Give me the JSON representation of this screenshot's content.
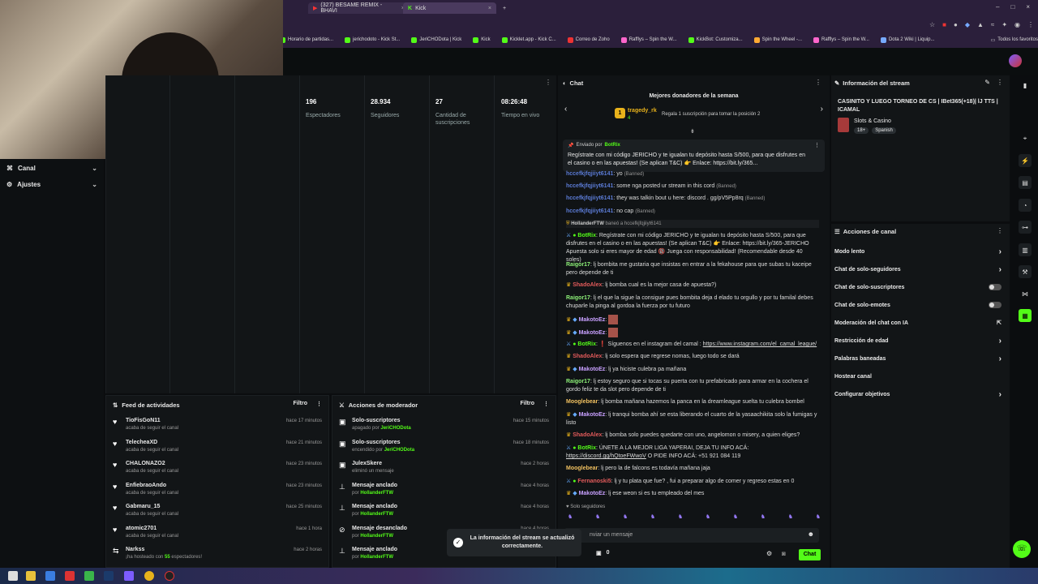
{
  "browser": {
    "tabs": [
      {
        "label": "(327) BESAME REMIX - BHAVI"
      },
      {
        "label": "Kick"
      }
    ],
    "new_tab": "+",
    "bookmarks": [
      "Horario de partidas...",
      "jerichodoto - Kick St...",
      "JeriCHODota | Kick",
      "Kick",
      "Kicklet.app - Kick C...",
      "Correo de Zoho",
      "Rafflys – Spin the W...",
      "KickBot: Customiza...",
      "Spin the Wheel -...",
      "Rafflys – Spin the W...",
      "Dota 2 Wiki | Liquip..."
    ],
    "all_bookmarks": "Todos los favoritos"
  },
  "sidebar": {
    "items": [
      {
        "label": "Canal"
      },
      {
        "label": "Ajustes"
      }
    ]
  },
  "stats": [
    {
      "value": "196",
      "label": "Espectadores"
    },
    {
      "value": "28.934",
      "label": "Seguidores"
    },
    {
      "value": "27",
      "label": "Cantidad de suscripciones"
    },
    {
      "value": "08:26:48",
      "label": "Tiempo en vivo"
    }
  ],
  "activity": {
    "title": "Feed de actividades",
    "filter": "Filtro",
    "rows": [
      {
        "name": "TioFisGoN11",
        "sub": "acaba de seguir el canal",
        "time": "hace 17 minutos",
        "icon": "heart-icon"
      },
      {
        "name": "TelecheaXD",
        "sub": "acaba de seguir el canal",
        "time": "hace 21 minutos",
        "icon": "heart-icon"
      },
      {
        "name": "CHALONAZO2",
        "sub": "acaba de seguir el canal",
        "time": "hace 23 minutos",
        "icon": "heart-icon"
      },
      {
        "name": "EnfiebraoAndo",
        "sub": "acaba de seguir el canal",
        "time": "hace 23 minutos",
        "icon": "heart-icon"
      },
      {
        "name": "Gabmaru_15",
        "sub": "acaba de seguir el canal",
        "time": "hace 25 minutos",
        "icon": "heart-icon"
      },
      {
        "name": "atomic2701",
        "sub": "acaba de seguir el canal",
        "time": "hace 1 hora",
        "icon": "heart-icon"
      },
      {
        "name": "Narkss",
        "sub_prefix": "¡ha hosteado con",
        "sub_count": "55",
        "sub_suffix": "espectadores!",
        "time": "hace 2 horas",
        "icon": "host-icon"
      }
    ]
  },
  "modactions": {
    "title": "Acciones de moderador",
    "filter": "Filtro",
    "rows": [
      {
        "name": "Solo-suscriptores",
        "pre": "apagado por",
        "by": "JeriCHODota",
        "time": "hace 15 minutos"
      },
      {
        "name": "Solo-suscriptores",
        "pre": "encendido por",
        "by": "JeriCHODota",
        "time": "hace 18 minutos"
      },
      {
        "name": "JulexSkere",
        "pre": "eliminó un mensaje",
        "by": "",
        "time": "hace 2 horas"
      },
      {
        "name": "Mensaje anclado",
        "pre": "por",
        "by": "HollanderFTW",
        "time": "hace 4 horas"
      },
      {
        "name": "Mensaje anclado",
        "pre": "por",
        "by": "HollanderFTW",
        "time": "hace 4 horas"
      },
      {
        "name": "Mensaje desanclado",
        "pre": "por",
        "by": "HollanderFTW",
        "time": "hace 4 horas"
      },
      {
        "name": "Mensaje anclado",
        "pre": "por",
        "by": "HollanderFTW",
        "time": ""
      }
    ]
  },
  "chat": {
    "title": "Chat",
    "top_donors_title": "Mejores donadores de la semana",
    "donor_rank": "1",
    "donor_name": "tragedy_rk",
    "donor_count": "4",
    "donor_cta": "Regala 1 suscripción para tomar la posición 2",
    "pinned_by_label": "Enviado por",
    "pinned_by": "BotRix",
    "pinned_text": "Regístrate con mi código JERICHO y te igualan tu depósito hasta S/500, para que disfrutes en el casino o en las apuestas! (Se aplican T&C) 👉 Enlace: https://bit.ly/365...",
    "messages": [
      {
        "user": "hccefkjfqjiiyt6141",
        "text": ": yo",
        "ban": "(Banned)",
        "color": "#5b7bd5"
      },
      {
        "user": "hccefkjfqjiiyt6141",
        "text": ": some nga posted ur stream in this cord",
        "ban": "(Banned)",
        "color": "#5b7bd5"
      },
      {
        "user": "hccefkjfqjiiyt6141",
        "text": ": they was talkin bout u here: discord . gg/pV5Pp8rq",
        "ban": "(Banned)",
        "color": "#5b7bd5"
      },
      {
        "user": "hccefkjfqjiiyt6141",
        "text": ": no cap",
        "ban": "(Banned)",
        "color": "#5b7bd5"
      }
    ],
    "ban_notice_user": "HollanderFTW",
    "ban_notice_text": "baneó a",
    "ban_notice_target": "hccefkjfqjiiyt6141",
    "m1_user": "BotRix",
    "m1_text": ": Regístrate con mi código JERICHO y te igualan tu depósito hasta S/500, para que disfrutes en el casino o en las apuestas! (Se aplican T&C) 👉 Enlace: https://bit.ly/365-JERICHO Apuesta solo si eres mayor de edad 🔞 Juega con responsabilidad! (Recomendable desde 40 soles)",
    "m2_user": "Raigor17",
    "m2_text": ": lj bombita me gustaria que insistas en entrar a la fekahouse para que subas tu kaceipe pero depende de ti",
    "m3_user": "ShadoAlex",
    "m3_text": ": lj bomba cual es la mejor casa de apuesta?)",
    "m4_user": "Raigor17",
    "m4_text": ": lj el que la sigue la consigue pues bombita deja d elado tu orgullo y por tu familal debes chuparle la pinga al gordoa la fuerza por tu futuro",
    "m5_user": "MakotoEz",
    "m6_user": "MakotoEz",
    "m7_user": "BotRix",
    "m7_text": ": ❗ Síguenos en el instagram del camal :",
    "m7_link": "https://www.instagram.com/el_camal_league/",
    "m8_user": "ShadoAlex",
    "m8_text": ": lj solo espera que regrese nomas, luego todo se dará",
    "m9_user": "MakotoEz",
    "m9_text": ": lj ya hiciste culebra pa mañana",
    "m10_user": "Raigor17",
    "m10_text": ": lj estoy seguro que si tocas su puerta con tu prefabricado para armar en la cochera el gordo feliz te da slot pero depende de ti",
    "m11_user": "Mooglebear",
    "m11_text": ": lj bomba mañana hazemos la panca en la dreamleague suelta tu culebra bombel",
    "m12_user": "MakotoEz",
    "m12_text": ": lj tranqui bomba ahí se esta liberando el cuarto de la yasaachikita solo la fumigas y listo",
    "m13_user": "ShadoAlex",
    "m13_text": ": lj bomba solo puedes quedarte con uno, angelomon o misery, a quien eliges?",
    "m14_user": "BotRix",
    "m14_text": ": ÚNETE A LA MEJOR LIGA YAPERAI, DEJA TU INFO ACÁ:",
    "m14_link": "https://discord.gg/hQtoeFWwoV",
    "m14_tail": "O PIDE INFO ACÁ: +51 921 084 119",
    "m15_user": "Mooglebear",
    "m15_text": ": lj pero la de falcons es todavía mañana jaja",
    "m16_user": "Fernanoski5",
    "m16_text": ": lj y tu plata que fue? , fui a preparar algo de comer y regreso estas en 0",
    "m17_user": "MakotoEz",
    "m17_text": ": lj ese weon si es tu empleado del mes",
    "followers_only": "Solo seguidores",
    "input_placeholder": "nviar un mensaje",
    "bank_count": "0",
    "send_label": "Chat"
  },
  "info": {
    "title": "Información del stream",
    "stream_title": "CASINITO Y LUEGO TORNEO DE CS | IBet365(+18)| lJ TTS | ICAMAL",
    "category": "Slots & Casino",
    "tags": [
      "18+",
      "Spanish"
    ]
  },
  "actions": {
    "title": "Acciones de canal",
    "items": [
      {
        "label": "Modo lento",
        "ctrl": "chevron"
      },
      {
        "label": "Chat de solo-seguidores",
        "ctrl": "chevron"
      },
      {
        "label": "Chat de solo-suscriptores",
        "ctrl": "toggle"
      },
      {
        "label": "Chat de solo-emotes",
        "ctrl": "toggle"
      },
      {
        "label": "Moderación del chat con IA",
        "ctrl": "external"
      },
      {
        "label": "Restricción de edad",
        "ctrl": "chevron"
      },
      {
        "label": "Palabras baneadas",
        "ctrl": "chevron"
      },
      {
        "label": "Hostear canal",
        "ctrl": "none"
      },
      {
        "label": "Configurar objetivos",
        "ctrl": "chevron"
      }
    ]
  },
  "toast": {
    "text": "La información del stream se actualizó correctamente."
  },
  "colors": {
    "accent": "#53fc18",
    "bg": "#0b0d0f",
    "panel": "#121517"
  }
}
